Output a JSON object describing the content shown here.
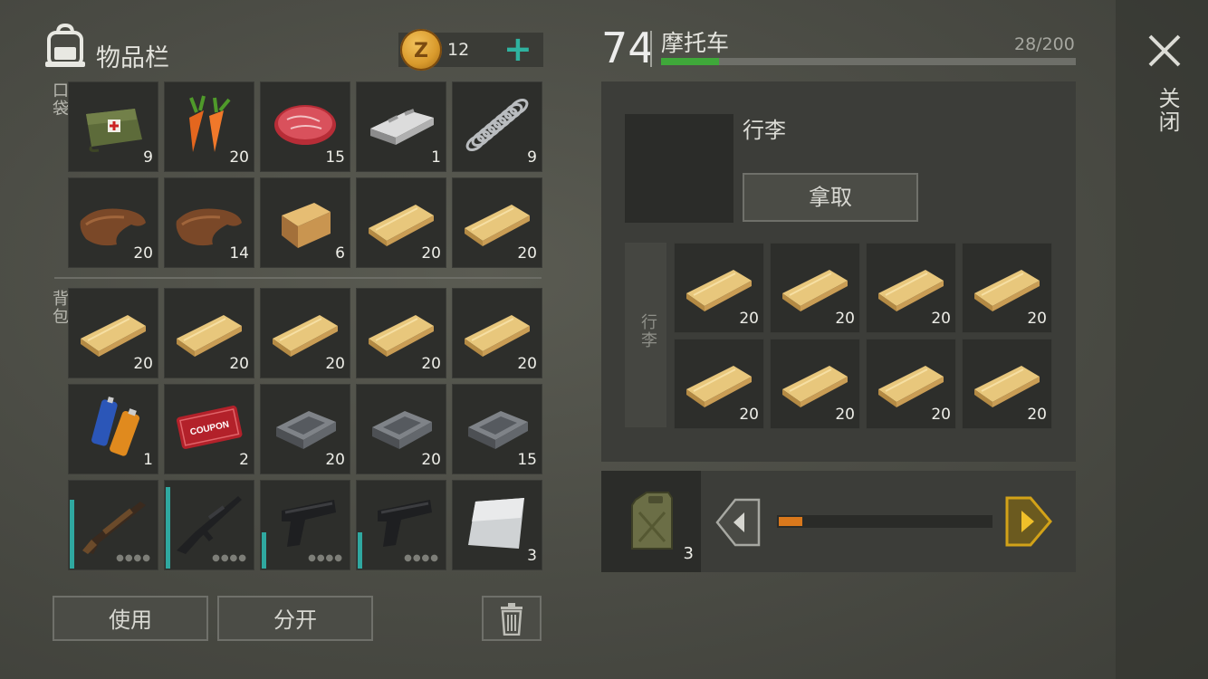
{
  "inventory": {
    "title": "物品栏",
    "coins": "12",
    "pocket_label": "口袋",
    "backpack_label": "背包",
    "use_button": "使用",
    "split_button": "分开"
  },
  "pocket_items": [
    {
      "name": "medkit-bag",
      "count": "9"
    },
    {
      "name": "carrot",
      "count": "20"
    },
    {
      "name": "raw-meat",
      "count": "15"
    },
    {
      "name": "metal-ingot",
      "count": "1"
    },
    {
      "name": "spring",
      "count": "9"
    },
    {
      "name": "leather",
      "count": "20"
    },
    {
      "name": "leather",
      "count": "14"
    },
    {
      "name": "wood-block",
      "count": "6"
    },
    {
      "name": "wood-plank",
      "count": "20"
    },
    {
      "name": "wood-plank",
      "count": "20"
    }
  ],
  "backpack_items": [
    {
      "name": "wood-plank",
      "count": "20"
    },
    {
      "name": "wood-plank",
      "count": "20"
    },
    {
      "name": "wood-plank",
      "count": "20"
    },
    {
      "name": "wood-plank",
      "count": "20"
    },
    {
      "name": "wood-plank",
      "count": "20"
    },
    {
      "name": "batteries",
      "count": "1"
    },
    {
      "name": "coupon",
      "count": "2"
    },
    {
      "name": "iron-ingot",
      "count": "20"
    },
    {
      "name": "iron-ingot",
      "count": "20"
    },
    {
      "name": "iron-ingot",
      "count": "15"
    },
    {
      "name": "shotgun",
      "count": ""
    },
    {
      "name": "assault-rifle",
      "count": ""
    },
    {
      "name": "pistol",
      "count": ""
    },
    {
      "name": "pistol",
      "count": ""
    },
    {
      "name": "metal-sheet",
      "count": "3"
    }
  ],
  "vehicle": {
    "level": "74",
    "name": "摩托车",
    "capacity": "28/200",
    "capacity_fraction": 0.14,
    "luggage_title": "行李",
    "take_button": "拿取",
    "luggage_side_label": "行李",
    "luggage_items": [
      "20",
      "20",
      "20",
      "20",
      "20",
      "20",
      "20",
      "20"
    ],
    "fuel_count": "3",
    "fuel_level": 0.11
  },
  "close_label": "关闭",
  "colors": {
    "accent_teal": "#2fb3a0",
    "capacity_green": "#3fa83a",
    "fuel_orange": "#d9781c",
    "arrow_gold": "#d2a218"
  }
}
